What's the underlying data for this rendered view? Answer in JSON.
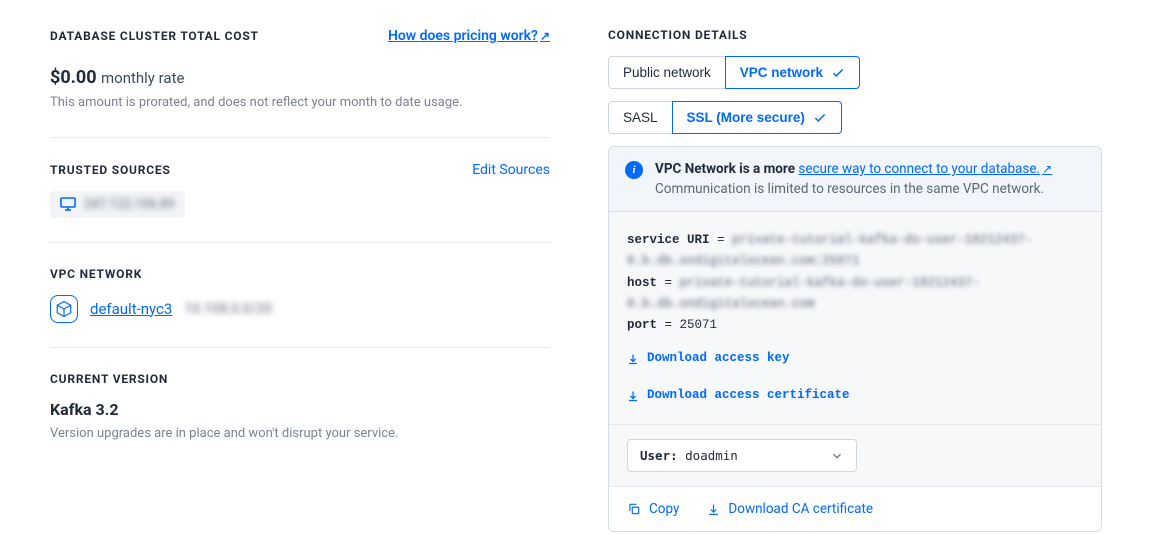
{
  "cost": {
    "heading": "DATABASE CLUSTER TOTAL COST",
    "pricing_link": "How does pricing work?",
    "amount": "$0.00",
    "rate_label": "monthly rate",
    "note": "This amount is prorated, and does not reflect your month to date usage."
  },
  "trusted_sources": {
    "heading": "TRUSTED SOURCES",
    "edit_label": "Edit Sources",
    "ip_masked": "247.122.106.89"
  },
  "vpc": {
    "heading": "VPC NETWORK",
    "name": "default-nyc3",
    "ip_masked": "10.108.0.0/20"
  },
  "version": {
    "heading": "CURRENT VERSION",
    "value": "Kafka 3.2",
    "note": "Version upgrades are in place and won't disrupt your service."
  },
  "connection": {
    "heading": "CONNECTION DETAILS",
    "network_tabs": {
      "public": "Public network",
      "vpc": "VPC network"
    },
    "auth_tabs": {
      "sasl": "SASL",
      "ssl": "SSL (More secure)"
    },
    "info_strong": "VPC Network is a more ",
    "info_link": "secure way to connect to your database.",
    "info_sub": "Communication is limited to resources in the same VPC network.",
    "service_label": "service URI",
    "service_uri_line1": "private-tutorial-kafka-do-user-18212437-",
    "service_uri_line2": "0.b.db.ondigitalocean.com:25071",
    "host_label": "host",
    "host_line1": "private-tutorial-kafka-do-user-18212437-",
    "host_line2": "0.b.db.ondigitalocean.com",
    "port_label": "port",
    "port_value": "25071",
    "dl_access_key": "Download access key",
    "dl_access_cert": "Download access certificate",
    "user_prefix": "User: ",
    "user_value": "doadmin",
    "copy_label": "Copy",
    "dl_ca_cert": "Download CA certificate"
  }
}
